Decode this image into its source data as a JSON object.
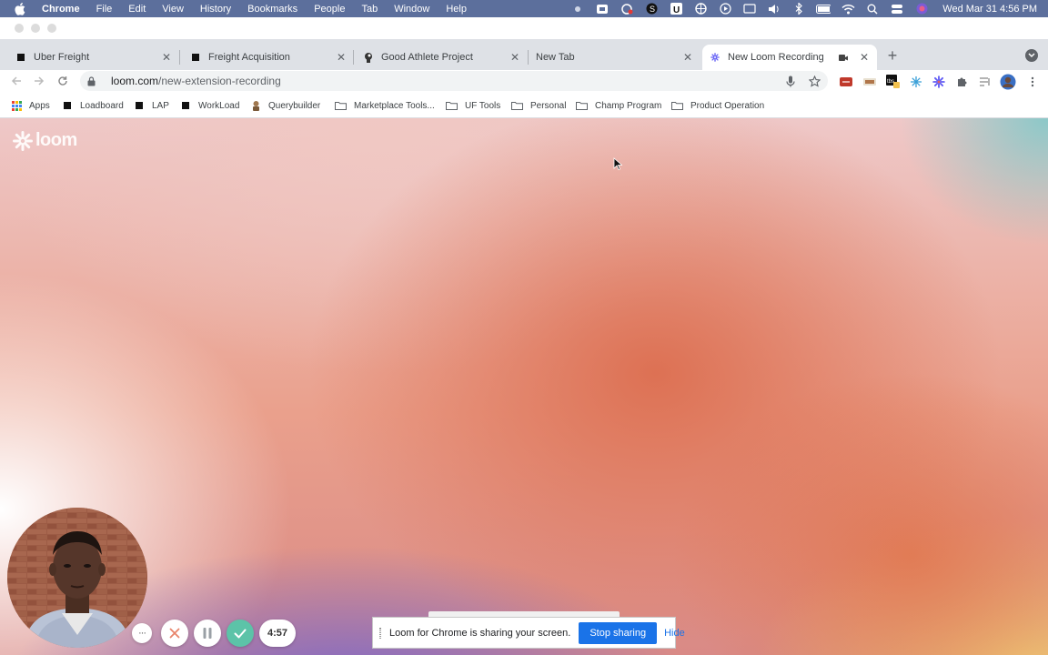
{
  "menubar": {
    "app_name": "Chrome",
    "items": [
      "File",
      "Edit",
      "View",
      "History",
      "Bookmarks",
      "People",
      "Tab",
      "Window",
      "Help"
    ],
    "clock": "Wed Mar 31  4:56 PM"
  },
  "tabs": [
    {
      "title": "Uber Freight",
      "icon": "black-square-icon"
    },
    {
      "title": "Freight Acquisition",
      "icon": "black-square-icon"
    },
    {
      "title": "Good Athlete Project",
      "icon": "head-icon"
    },
    {
      "title": "New Tab",
      "icon": ""
    },
    {
      "title": "New Loom Recording",
      "icon": "loom-icon",
      "active": true
    }
  ],
  "omnibox": {
    "host": "loom.com",
    "path": "/new-extension-recording"
  },
  "bookmarks": [
    {
      "label": "Apps",
      "icon": "apps-grid-icon"
    },
    {
      "label": "Loadboard",
      "icon": "black-square-icon"
    },
    {
      "label": "LAP",
      "icon": "black-square-icon"
    },
    {
      "label": "WorkLoad",
      "icon": "black-square-icon"
    },
    {
      "label": "Querybuilder",
      "icon": "querybuilder-icon"
    },
    {
      "label": "Marketplace Tools...",
      "icon": "folder-icon"
    },
    {
      "label": "UF Tools",
      "icon": "folder-icon"
    },
    {
      "label": "Personal",
      "icon": "folder-icon"
    },
    {
      "label": "Champ Program",
      "icon": "folder-icon"
    },
    {
      "label": "Product Operation",
      "icon": "folder-icon"
    }
  ],
  "page": {
    "logo_text": "loom"
  },
  "recorder": {
    "more_label": "···",
    "timer": "4:57"
  },
  "sharebar": {
    "message": "Loom for Chrome is sharing your screen.",
    "stop_label": "Stop sharing",
    "hide_label": "Hide"
  },
  "colors": {
    "accent": "#1a73e8",
    "loom_check": "#5cc3a8",
    "menubar": "#5c6f9c"
  }
}
